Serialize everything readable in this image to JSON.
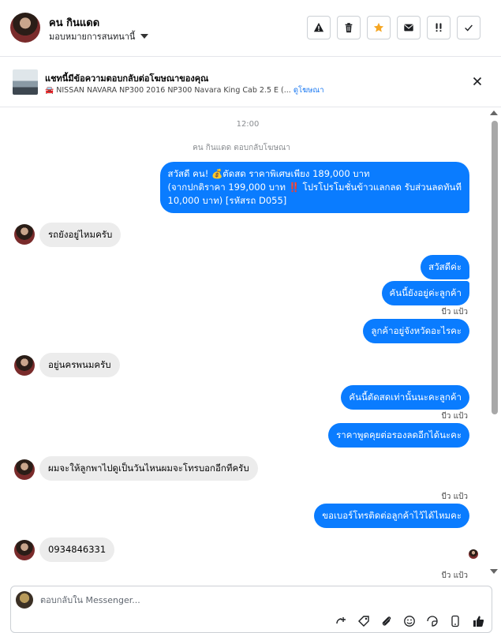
{
  "header": {
    "name": "คน กินแดด",
    "assign_label": "มอบหมายการสนทนานี้",
    "tools": [
      {
        "icon": "warning-icon"
      },
      {
        "icon": "trash-icon"
      },
      {
        "icon": "star-icon",
        "color": "#f5a623"
      },
      {
        "icon": "envelope-icon"
      },
      {
        "icon": "exclamation-icon"
      },
      {
        "icon": "check-icon"
      }
    ]
  },
  "ad": {
    "title": "แชทนี้มีข้อความตอบกลับต่อโฆษณาของคุณ",
    "subtitle": "NISSAN NAVARA NP300 2016 NP300 Navara King Cab 2.5 E (...",
    "link": "ดูโฆษณา"
  },
  "chat": {
    "time": "12:00",
    "system_note": "คน กินแดด ตอบกลับโฆษณา",
    "messages": [
      {
        "lines": [
          "สวัสดี คน! 💰ตัดสด ราคาพิเศษเพียง 189,000 บาท",
          "(จากปกติราคา 199,000 บาท ‼️ โปรโปรโมชั่นข้าวแลกลด รับส่วนลดทันที",
          "10,000 บาท) [รหัสรถ D055]"
        ]
      },
      {
        "text": "รถยังอยู่ไหมครับ"
      },
      {
        "text": "สวัสดีค่ะ"
      },
      {
        "text": "คันนี้ยังอยู่ค่ะลูกค้า"
      },
      {
        "sender": "บีว แป้ว"
      },
      {
        "text": "ลูกค้าอยู่จังหวัดอะไรคะ"
      },
      {
        "text": "อยู่นครพนมครับ"
      },
      {
        "text": "คันนี้ตัดสดเท่านั้นนะคะลูกค้า"
      },
      {
        "sender": "บีว แป้ว"
      },
      {
        "text": "ราคาพูดคุยต่อรองลดอีกได้นะคะ"
      },
      {
        "text": "ผมจะให้ลูกพาไปดูเป็นวันไหนผมจะโทรบอกอีกทีครับ"
      },
      {
        "sender": "บีว แป้ว"
      },
      {
        "text": "ขอเบอร์โทรติดต่อลูกค้าไว้ได้ไหมคะ"
      },
      {
        "text": "0934846331"
      },
      {
        "sender": "บีว แป้ว"
      }
    ]
  },
  "composer": {
    "placeholder": "ตอบกลับใน Messenger..."
  },
  "colors": {
    "outgoing_bubble": "#0a7cff",
    "incoming_bubble": "#ececec",
    "link": "#1877f2"
  }
}
